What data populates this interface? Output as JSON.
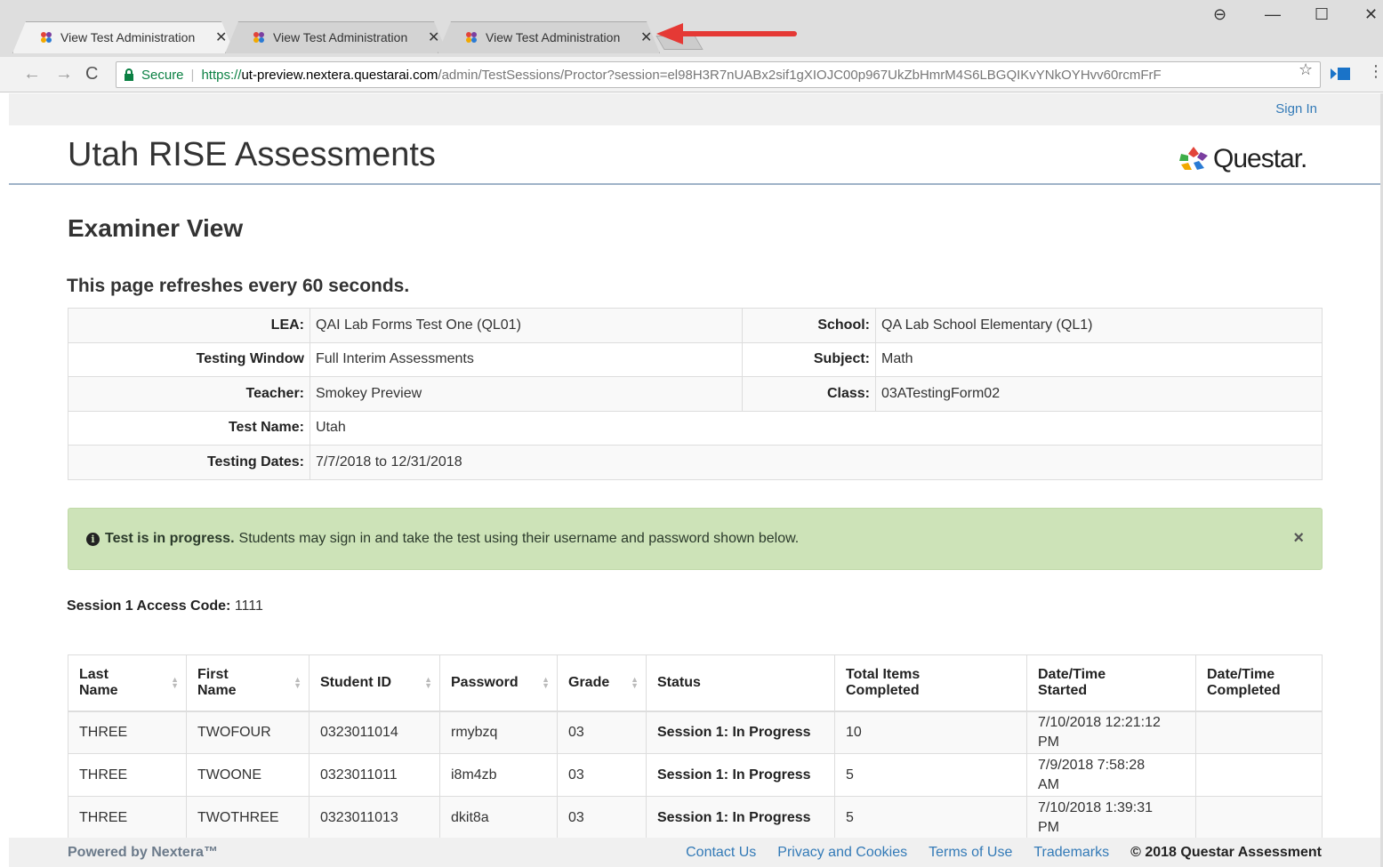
{
  "browser": {
    "tabs": [
      {
        "title": "View Test Administration",
        "active": true
      },
      {
        "title": "View Test Administration",
        "active": false
      },
      {
        "title": "View Test Administration",
        "active": false
      }
    ],
    "close_glyph": "✕",
    "window_controls": {
      "profile": "⊖",
      "minimize": "—",
      "maximize": "☐",
      "close": "✕"
    },
    "secure_label": "Secure",
    "url_proto": "https://",
    "url_host": "ut-preview.nextera.questarai.com",
    "url_path": "/admin/TestSessions/Proctor?session=el98H3R7nUABx2sif1gXIOJC00p967UkZbHmrM4S6LBGQIKvYNkOYHvv60rcmFrF",
    "accent_arrow_color": "#e53935"
  },
  "header": {
    "sign_in": "Sign In",
    "app_title": "Utah RISE Assessments",
    "logo_text": "Questar."
  },
  "main": {
    "view_title": "Examiner View",
    "refresh_note": "This page refreshes every 60 seconds.",
    "info": {
      "lea_label": "LEA:",
      "lea_value": "QAI Lab Forms Test One (QL01)",
      "school_label": "School:",
      "school_value": "QA Lab School Elementary (QL1)",
      "window_label": "Testing Window",
      "window_value": "Full Interim Assessments",
      "subject_label": "Subject:",
      "subject_value": "Math",
      "teacher_label": "Teacher:",
      "teacher_value": "Smokey Preview",
      "class_label": "Class:",
      "class_value": "03ATestingForm02",
      "test_label": "Test Name:",
      "test_value": "Utah",
      "dates_label": "Testing Dates:",
      "dates_value": "7/7/2018 to 12/31/2018"
    },
    "alert": {
      "icon": "i",
      "bold": "Test is in progress.",
      "text": "Students may sign in and take the test using their username and password shown below.",
      "close": "×"
    },
    "access": {
      "label": "Session 1 Access Code:",
      "value": "1111"
    },
    "roster": {
      "headers": {
        "last": "Last Name",
        "first": "First Name",
        "id": "Student ID",
        "password": "Password",
        "grade": "Grade",
        "status": "Status",
        "items": "Total Items Completed",
        "started": "Date/Time Started",
        "completed": "Date/Time Completed"
      },
      "rows": [
        {
          "last": "THREE",
          "first": "TWOFOUR",
          "id": "0323011014",
          "password": "rmybzq",
          "grade": "03",
          "status": "Session 1: In Progress",
          "items": "10",
          "started": "7/10/2018 12:21:12 PM",
          "completed": ""
        },
        {
          "last": "THREE",
          "first": "TWOONE",
          "id": "0323011011",
          "password": "i8m4zb",
          "grade": "03",
          "status": "Session 1: In Progress",
          "items": "5",
          "started": "7/9/2018 7:58:28 AM",
          "completed": ""
        },
        {
          "last": "THREE",
          "first": "TWOTHREE",
          "id": "0323011013",
          "password": "dkit8a",
          "grade": "03",
          "status": "Session 1: In Progress",
          "items": "5",
          "started": "7/10/2018 1:39:31 PM",
          "completed": ""
        }
      ]
    }
  },
  "footer": {
    "powered": "Powered by Nextera™",
    "links": [
      "Contact Us",
      "Privacy and Cookies",
      "Terms of Use",
      "Trademarks"
    ],
    "copyright": "© 2018 Questar Assessment"
  }
}
